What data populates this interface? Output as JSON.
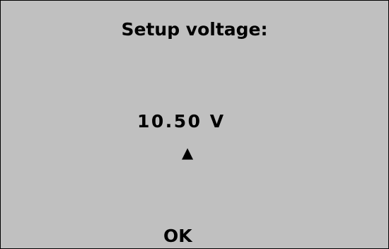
{
  "screen": {
    "title": "Setup voltage:",
    "value": "10.50",
    "unit": "V",
    "cursor_glyph": "▲",
    "ok_label": "OK"
  },
  "colors": {
    "background": "#c0c0c0",
    "text": "#000000",
    "border": "#000000"
  },
  "icons": {
    "cursor": "up-triangle-icon"
  }
}
